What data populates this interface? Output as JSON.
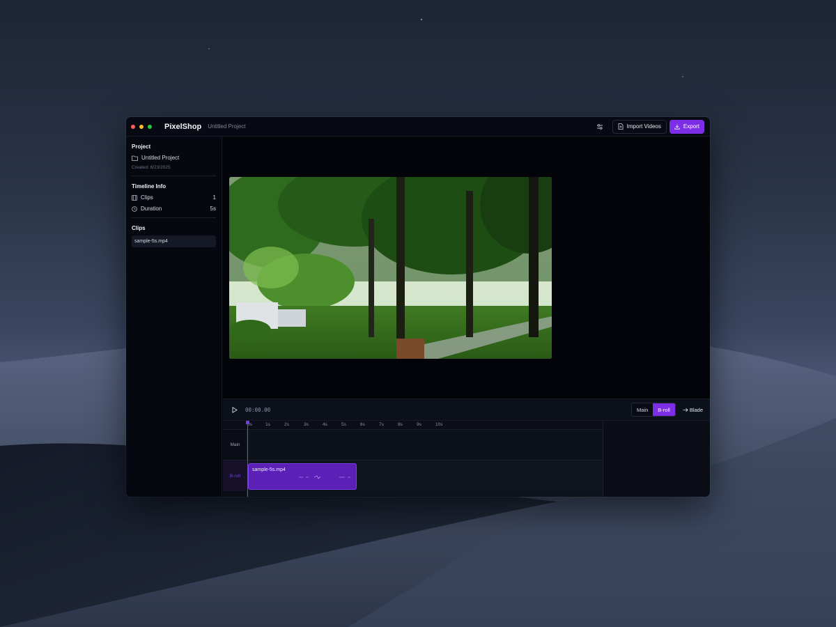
{
  "app": {
    "name": "PixelShop",
    "project_name": "Untitled Project"
  },
  "toolbar": {
    "settings_icon": "sliders-icon",
    "import_label": "Import Videos",
    "export_label": "Export"
  },
  "sidebar": {
    "project_title": "Project",
    "project_name": "Untitled Project",
    "created": "Created: 6/23/2025",
    "timeline_info_title": "Timeline Info",
    "clips_label": "Clips",
    "clips_value": "1",
    "duration_label": "Duration",
    "duration_value": "5s",
    "clips_title": "Clips",
    "clips": [
      "sample-5s.mp4"
    ]
  },
  "controls": {
    "timecode": "00:00.00",
    "main_label": "Main",
    "broll_label": "B-roll",
    "blade_label": "Blade"
  },
  "timeline": {
    "ticks": [
      "0s",
      "1s",
      "2s",
      "3s",
      "4s",
      "5s",
      "6s",
      "7s",
      "8s",
      "9s",
      "10s"
    ],
    "tracks": [
      "Main",
      "B-roll"
    ],
    "clip_name": "sample-5s.mp4"
  },
  "colors": {
    "accent": "#7c2ee6",
    "window_bg": "#04070e"
  }
}
